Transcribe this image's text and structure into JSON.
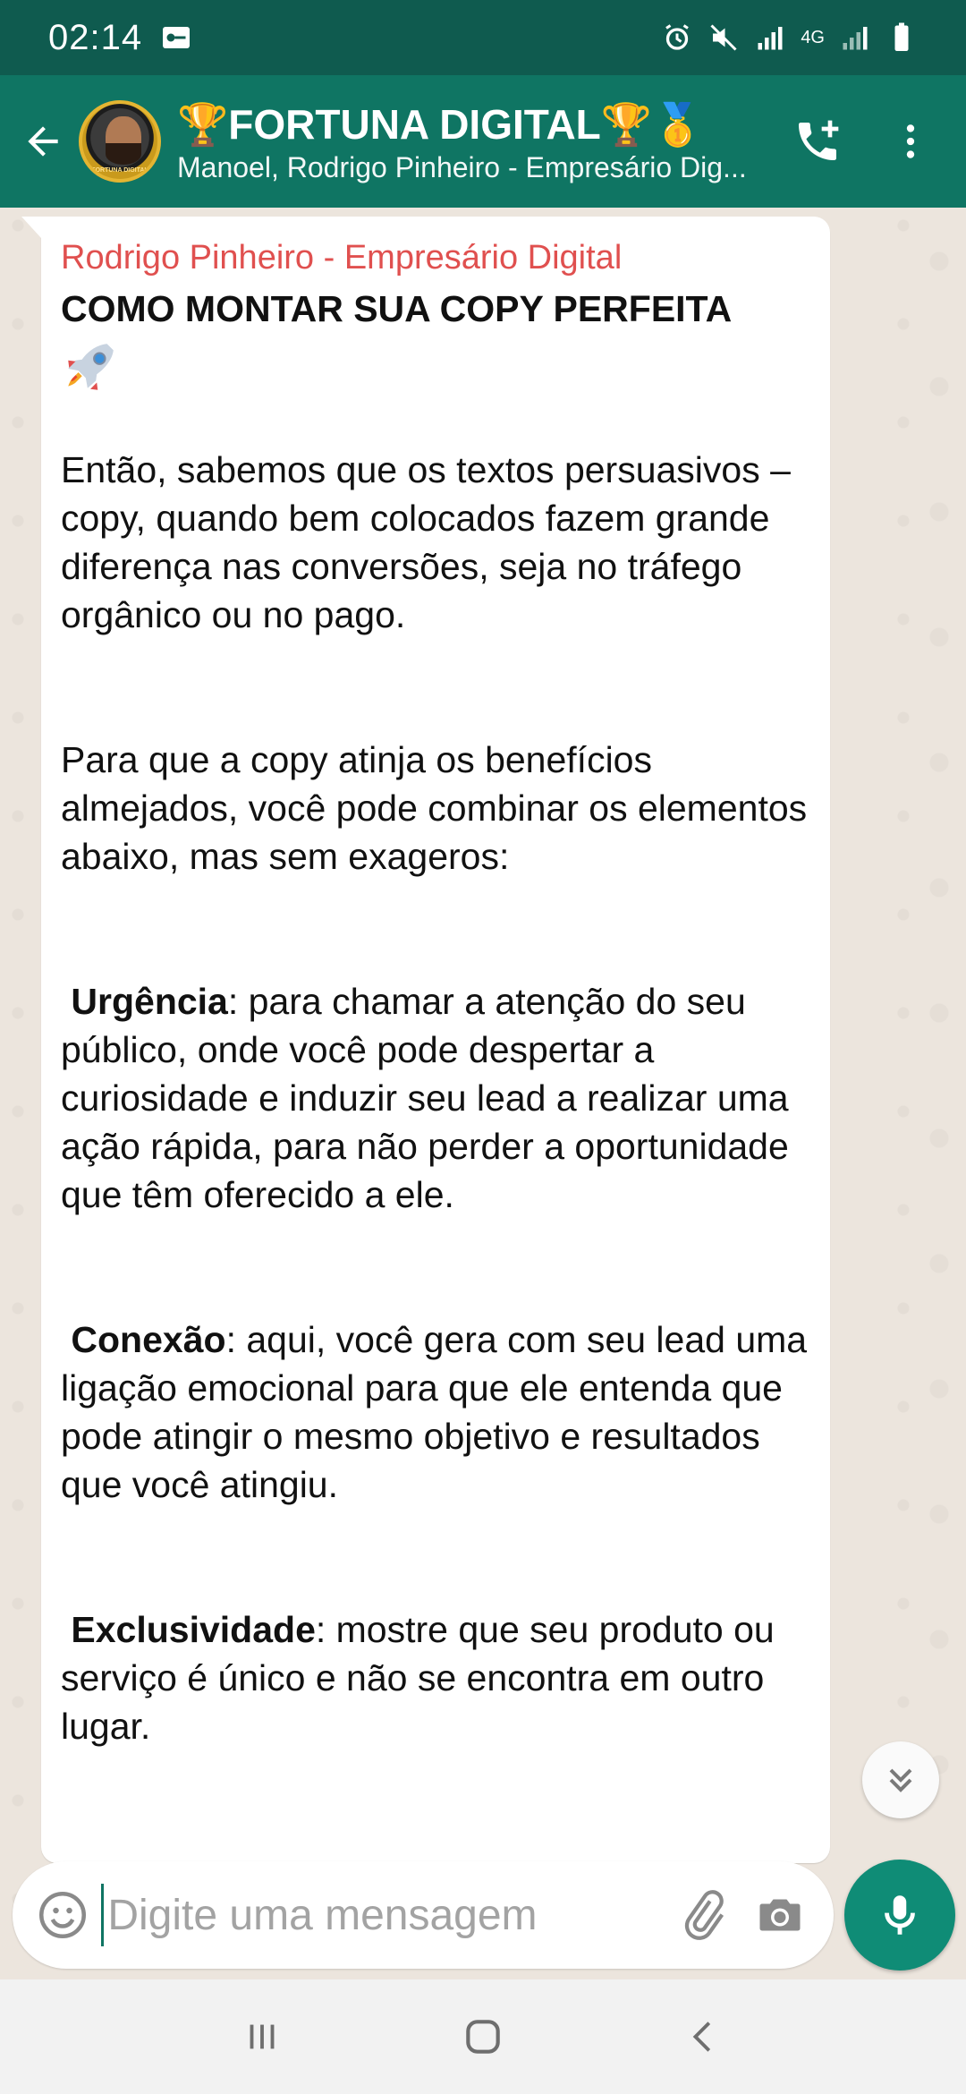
{
  "status_bar": {
    "time": "02:14",
    "network": "4G"
  },
  "header": {
    "title": "🏆FORTUNA DIGITAL🏆🥇",
    "subtitle": "Manoel, Rodrigo Pinheiro - Empresário Dig...",
    "avatar_caption": "FORTUNA DIGITAL"
  },
  "message": {
    "sender": "Rodrigo Pinheiro - Empresário Digital",
    "title": "COMO MONTAR SUA COPY PERFEITA",
    "p1": "Então, sabemos que os textos persuasivos – copy, quando bem colocados fazem grande diferença nas conversões, seja no tráfego orgânico ou no pago.",
    "p2": "Para que a copy atinja os benefícios almejados, você pode combinar os elementos abaixo, mas sem exageros:",
    "item1_label": "Urgência",
    "item1_text": ": para chamar a atenção do seu público, onde você pode despertar a curiosidade e induzir seu lead a realizar uma ação rápida, para não perder a oportunidade que têm oferecido a ele.",
    "item2_label": "Conexão",
    "item2_text": ": aqui, você gera com seu lead uma ligação emocional para que ele entenda que pode atingir o mesmo objetivo e resultados que você atingiu.",
    "item3_label": "Exclusividade",
    "item3_text": ": mostre que seu produto ou serviço é único e não se encontra em outro lugar."
  },
  "composer": {
    "placeholder": "Digite uma mensagem"
  },
  "colors": {
    "header": "#0f7563",
    "status": "#0f5b4f",
    "sender": "#e0504f",
    "accent": "#0f8c76"
  }
}
